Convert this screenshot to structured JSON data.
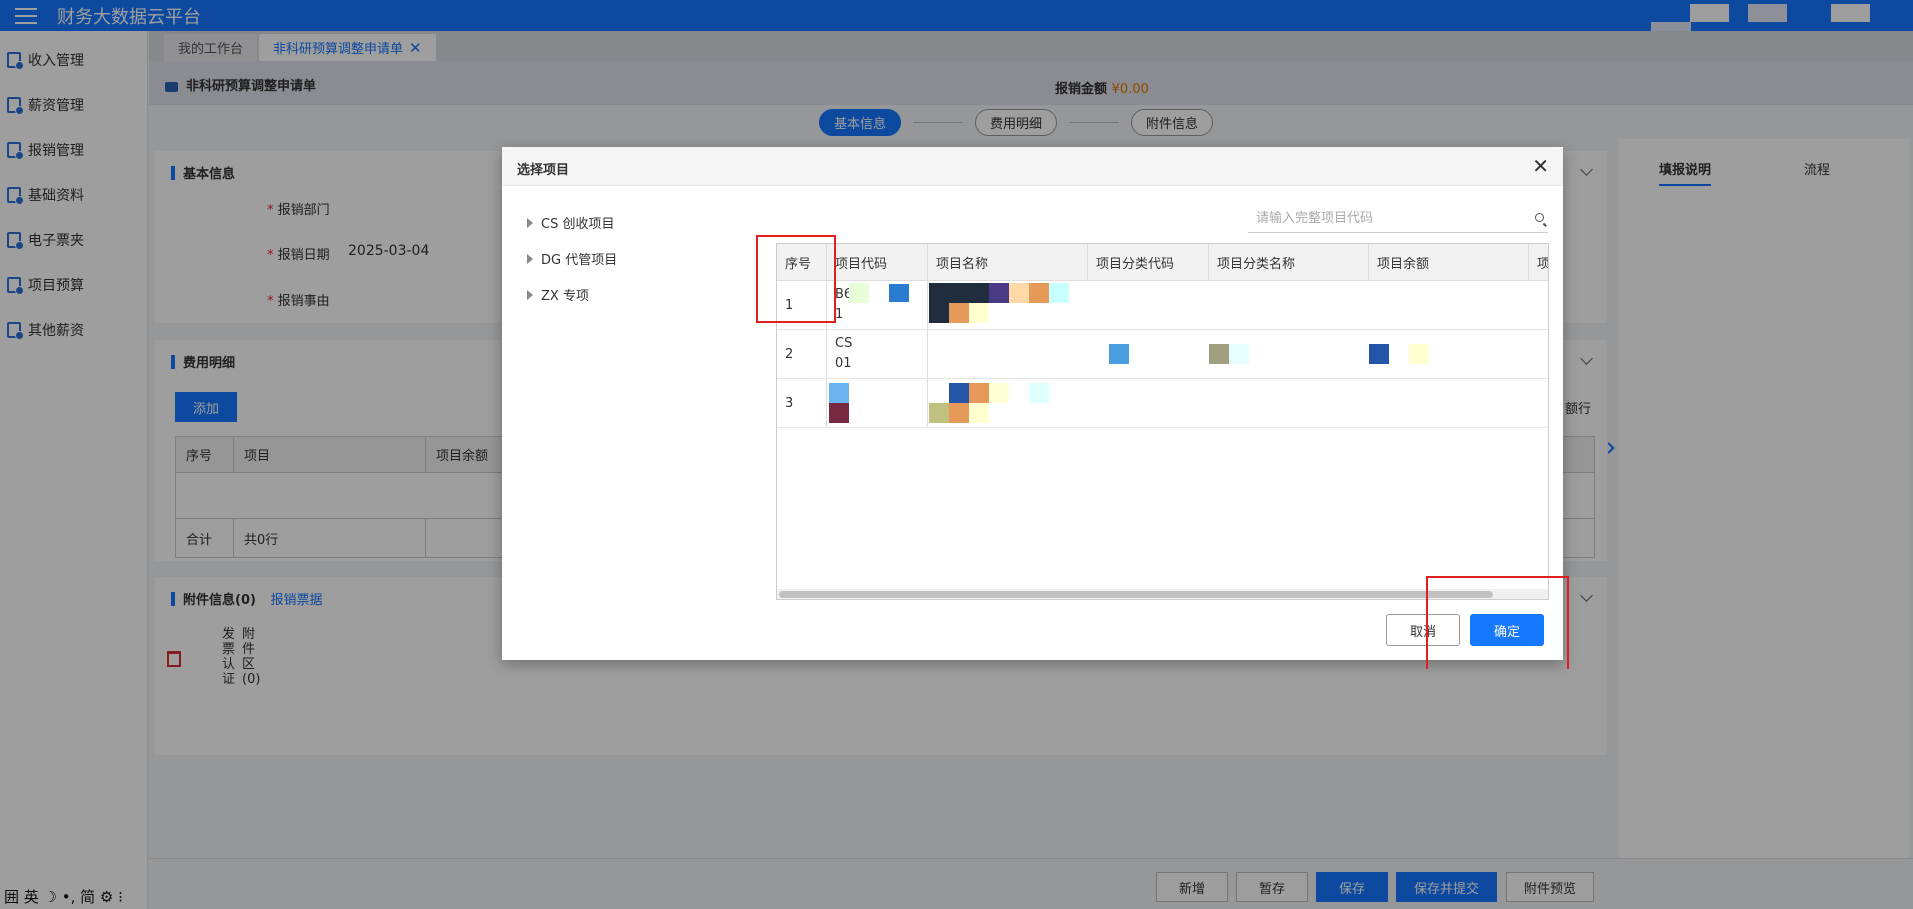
{
  "app": {
    "title": "财务大数据云平台"
  },
  "sidebar": {
    "items": [
      {
        "label": "收入管理"
      },
      {
        "label": "薪资管理"
      },
      {
        "label": "报销管理"
      },
      {
        "label": "基础资料"
      },
      {
        "label": "电子票夹"
      },
      {
        "label": "项目预算"
      },
      {
        "label": "其他薪资"
      }
    ]
  },
  "ime": {
    "text": "囲 英 ☽ •, 简 ⚙ ⁝"
  },
  "tabs": [
    {
      "label": "我的工作台"
    },
    {
      "label": "非科研预算调整申请单"
    }
  ],
  "form": {
    "title": "非科研预算调整申请单",
    "amount_label": "报销金额",
    "amount_value": "¥0.00"
  },
  "steps": [
    {
      "label": "基本信息"
    },
    {
      "label": "费用明细"
    },
    {
      "label": "附件信息"
    }
  ],
  "basic": {
    "title": "基本信息",
    "dept_label": "报销部门",
    "date_label": "报销日期",
    "date_value": "2025-03-04",
    "reason_label": "报销事由"
  },
  "expense": {
    "title": "费用明细",
    "add_label": "添加",
    "cols": [
      "序号",
      "项目",
      "项目余额"
    ],
    "total_label": "合计",
    "total_rows": "共0行",
    "cut_text": "额行"
  },
  "attach": {
    "title": "附件信息(0)",
    "link": "报销票据",
    "col1": "发票认证",
    "col2": "附件区(0)"
  },
  "right_panel": {
    "tab1": "填报说明",
    "tab2": "流程"
  },
  "bottom": {
    "new": "新增",
    "draft": "暂存",
    "save": "保存",
    "save_submit": "保存并提交",
    "preview": "附件预览"
  },
  "modal": {
    "title": "选择项目",
    "tree": [
      {
        "label": "CS 创收项目"
      },
      {
        "label": "DG 代管项目"
      },
      {
        "label": "ZX 专项"
      }
    ],
    "search_placeholder": "请输入完整项目代码",
    "columns": [
      "序号",
      "项目代码",
      "项目名称",
      "项目分类代码",
      "项目分类名称",
      "项目余额",
      "项"
    ],
    "rows": [
      {
        "no": "1",
        "code": "B6\n1"
      },
      {
        "no": "2",
        "code": "CS\n01"
      },
      {
        "no": "3",
        "code": ""
      }
    ],
    "cancel_label": "取消",
    "ok_label": "确定"
  },
  "colors": {
    "primary": "#1677ff",
    "highlight": "#e02020",
    "amount": "#e07b00"
  }
}
